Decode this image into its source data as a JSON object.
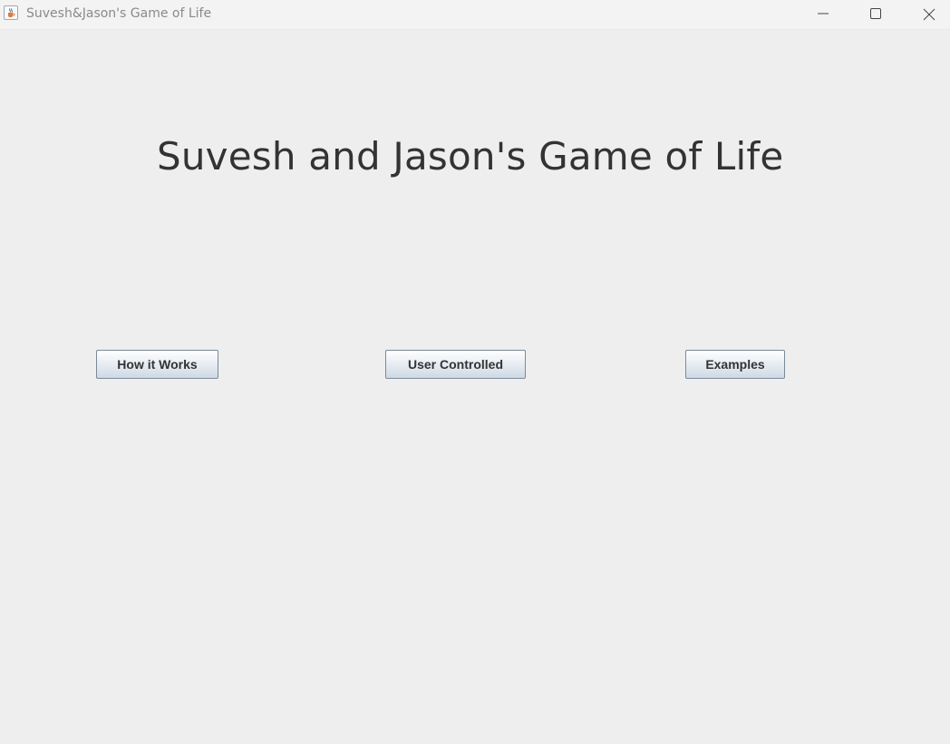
{
  "window": {
    "title": "Suvesh&Jason's Game of Life",
    "app_icon": "java-cup-icon",
    "controls": {
      "minimize_icon": "minimize-icon",
      "maximize_icon": "maximize-icon",
      "close_icon": "close-icon"
    }
  },
  "main": {
    "heading": "Suvesh and Jason's Game of Life",
    "buttons": [
      {
        "label": "How it Works"
      },
      {
        "label": "User Controlled"
      },
      {
        "label": "Examples"
      }
    ]
  },
  "colors": {
    "background": "#eeeeee",
    "titlebar": "#f3f3f3",
    "heading_text": "#333333",
    "button_border": "#7a8a99",
    "button_gradient_bottom": "#cfd9e4"
  }
}
